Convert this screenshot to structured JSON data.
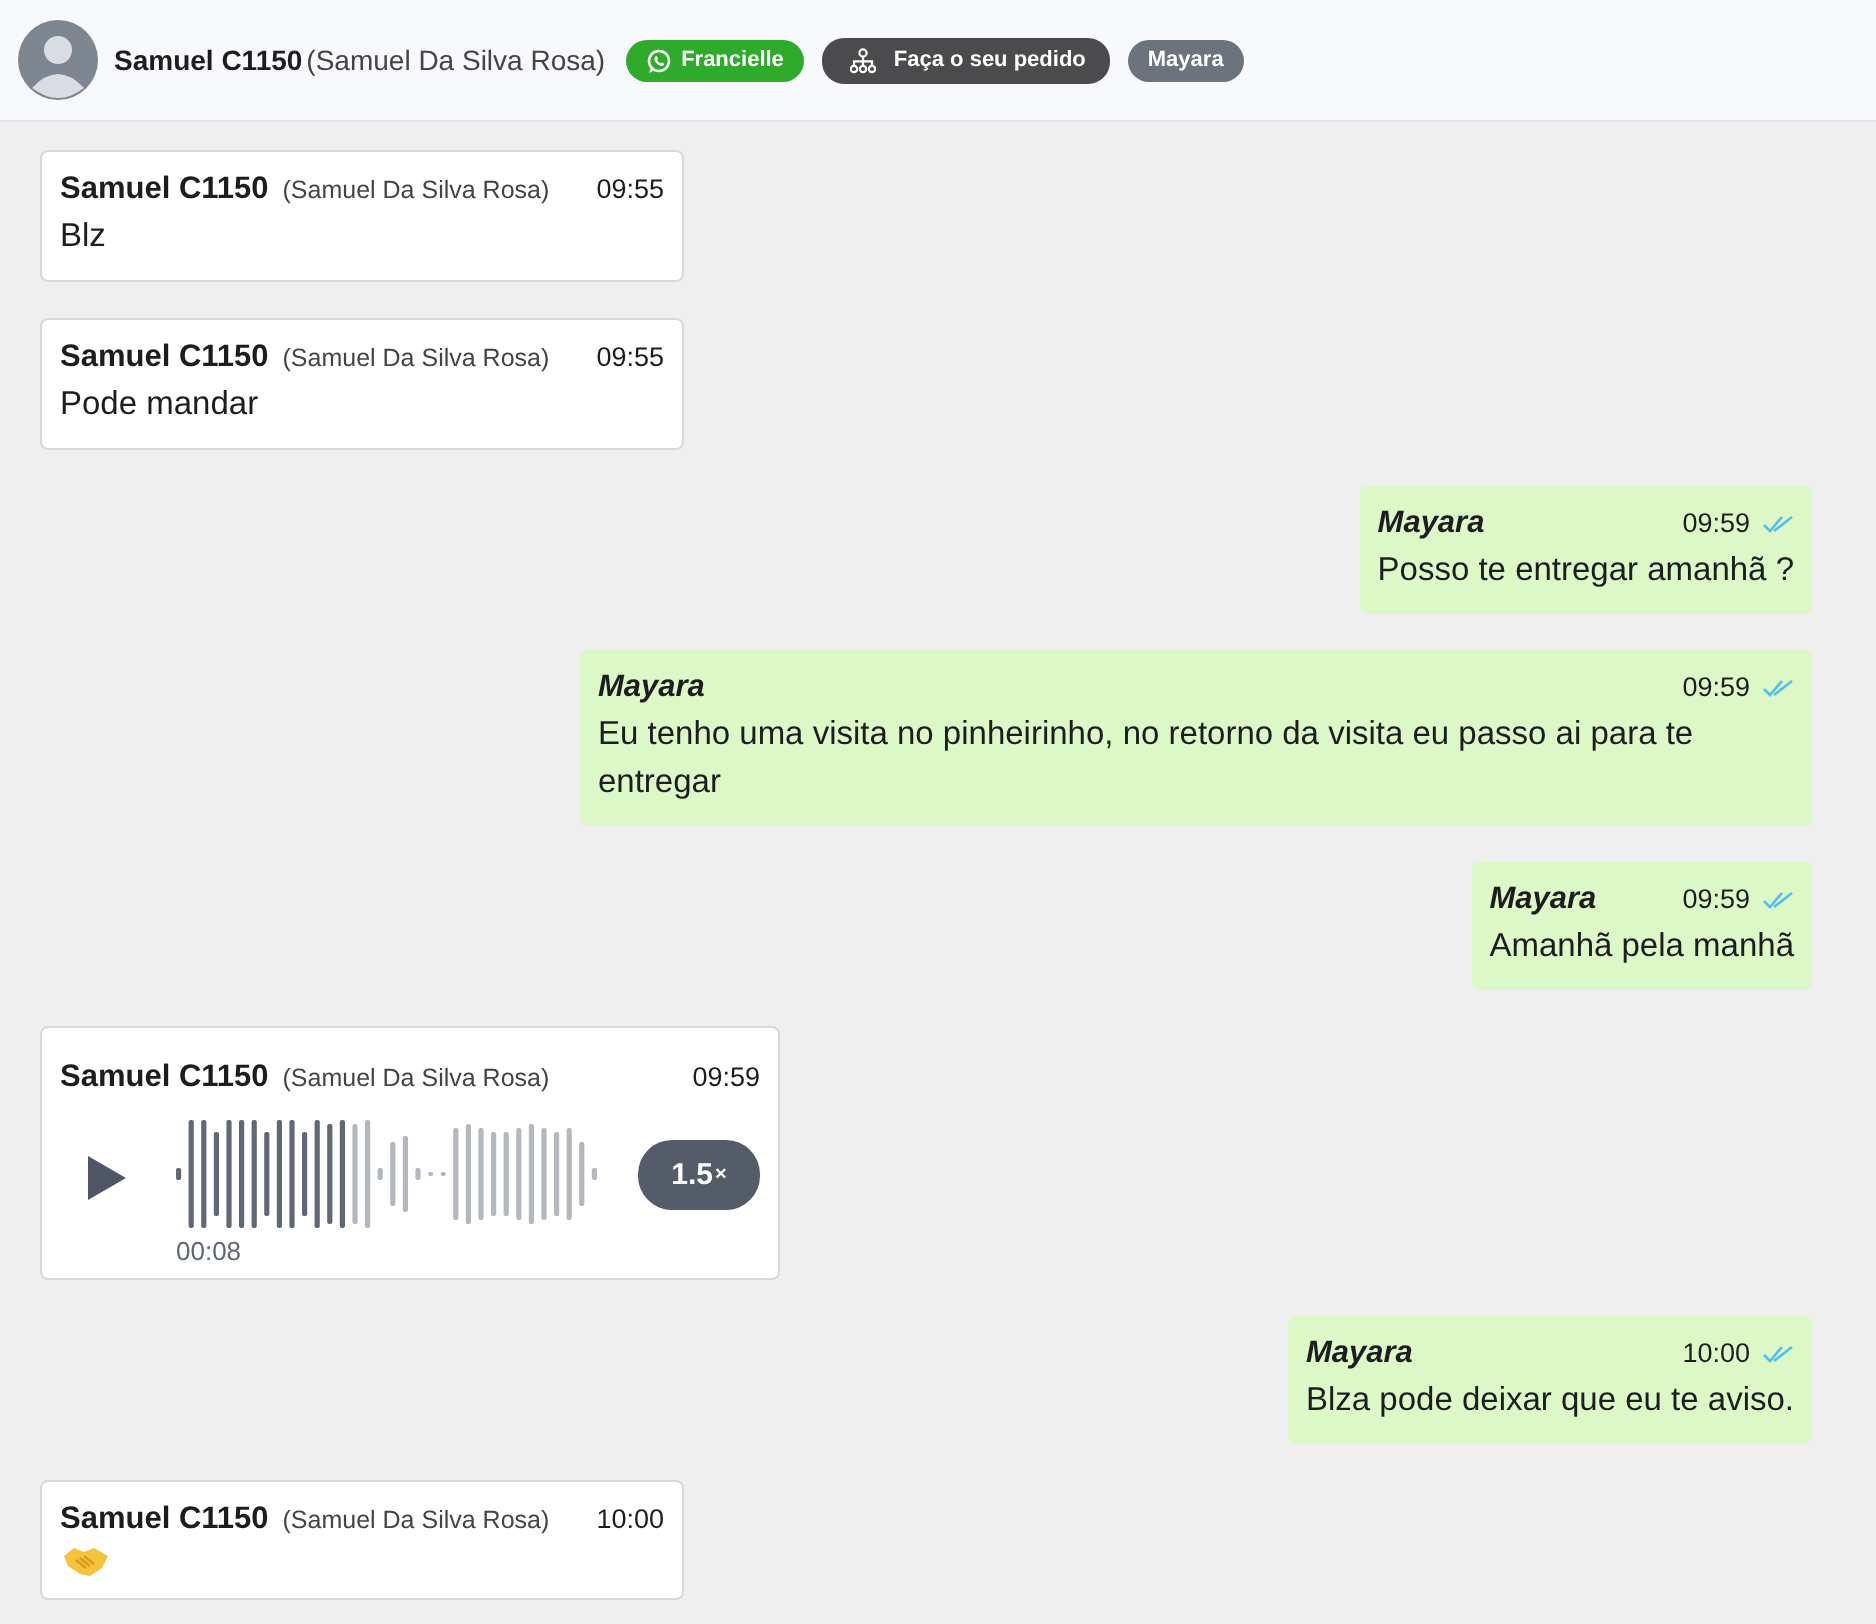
{
  "contact": {
    "name": "Samuel C1150",
    "full_name": "(Samuel Da Silva Rosa)"
  },
  "tags": [
    {
      "kind": "whatsapp",
      "label": "Francielle",
      "color": "#2eab2b"
    },
    {
      "kind": "flow",
      "label": "Faça o seu pedido",
      "color": "#4b4b4d"
    },
    {
      "kind": "plain",
      "label": "Mayara",
      "color": "#6c737c"
    }
  ],
  "messages": [
    {
      "kind": "text",
      "outgoing": false,
      "sender": "Samuel C1150",
      "sender_full": "(Samuel Da Silva Rosa)",
      "time": "09:55",
      "text": "Blz"
    },
    {
      "kind": "text",
      "outgoing": false,
      "sender": "Samuel C1150",
      "sender_full": "(Samuel Da Silva Rosa)",
      "time": "09:55",
      "text": "Pode mandar"
    },
    {
      "kind": "text",
      "outgoing": true,
      "sender": "Mayara",
      "time": "09:59",
      "read": true,
      "text": "Posso te entregar amanhã ?"
    },
    {
      "kind": "text",
      "outgoing": true,
      "sender": "Mayara",
      "time": "09:59",
      "read": true,
      "text": "Eu tenho uma visita no pinheirinho, no retorno da visita eu passo ai para te entregar"
    },
    {
      "kind": "text",
      "outgoing": true,
      "sender": "Mayara",
      "time": "09:59",
      "read": true,
      "text": "Amanhã pela manhã"
    },
    {
      "kind": "audio",
      "outgoing": false,
      "sender": "Samuel C1150",
      "sender_full": "(Samuel Da Silva Rosa)",
      "time": "09:59",
      "level": 0.42,
      "duration": "00:08",
      "speed": "1.5",
      "speed_unit": "×"
    },
    {
      "kind": "text",
      "outgoing": true,
      "sender": "Mayara",
      "time": "10:00",
      "read": true,
      "text": "Blza pode deixar que eu te aviso."
    },
    {
      "kind": "emoji",
      "outgoing": false,
      "sender": "Samuel C1150",
      "sender_full": "(Samuel Da Silva Rosa)",
      "time": "10:00"
    }
  ]
}
